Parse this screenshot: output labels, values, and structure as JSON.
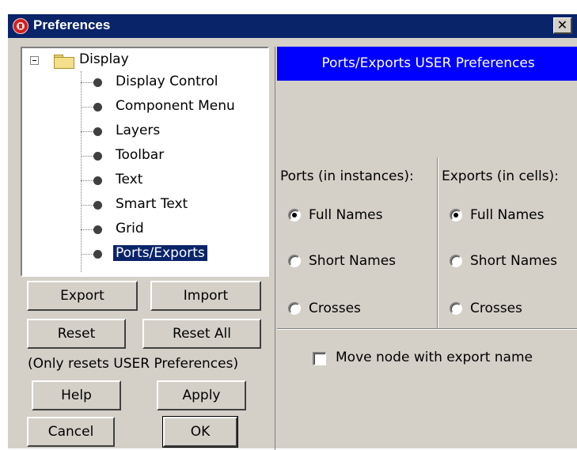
{
  "window": {
    "title": "Preferences",
    "close_label": "✕"
  },
  "tree": {
    "root_label": "Display",
    "items": [
      {
        "label": "Display Control"
      },
      {
        "label": "Component Menu"
      },
      {
        "label": "Layers"
      },
      {
        "label": "Toolbar"
      },
      {
        "label": "Text"
      },
      {
        "label": "Smart Text"
      },
      {
        "label": "Grid"
      },
      {
        "label": "Ports/Exports",
        "selected": true
      }
    ]
  },
  "buttons": {
    "export": "Export",
    "import": "Import",
    "reset": "Reset",
    "reset_all": "Reset All",
    "reset_note": "(Only resets USER Preferences)",
    "help": "Help",
    "apply": "Apply",
    "cancel": "Cancel",
    "ok": "OK"
  },
  "panel": {
    "header": "Ports/Exports USER Preferences",
    "ports": {
      "heading": "Ports (in instances):",
      "options": [
        "Full Names",
        "Short Names",
        "Crosses"
      ],
      "selected": "Full Names"
    },
    "exports": {
      "heading": "Exports (in cells):",
      "options": [
        "Full Names",
        "Short Names",
        "Crosses"
      ],
      "selected": "Full Names"
    },
    "move_node": {
      "label": "Move node with export name",
      "checked": false
    }
  },
  "colors": {
    "title_bar": "#0a246a",
    "panel_header": "#0000ff",
    "window_bg": "#d4d0c8"
  }
}
